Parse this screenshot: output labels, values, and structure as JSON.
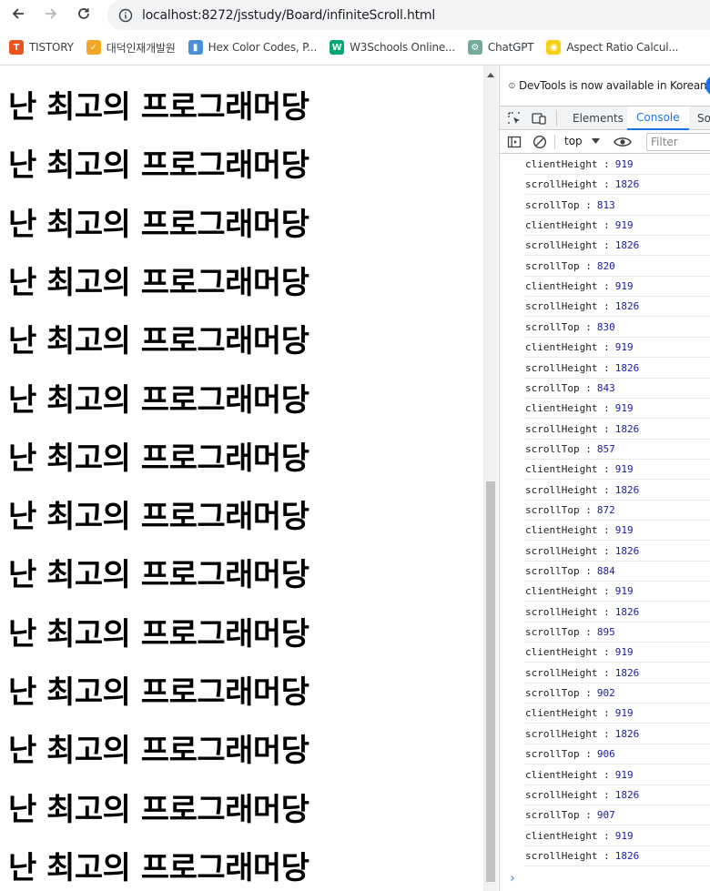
{
  "browser": {
    "url": "localhost:8272/jsstudy/Board/infiniteScroll.html",
    "bookmarks": [
      {
        "label": "TISTORY",
        "icon": "tistory-icon",
        "color": "#eb531f",
        "glyph": "T"
      },
      {
        "label": "대덕인재개발원",
        "icon": "ddit-icon",
        "color": "#f5a623",
        "glyph": "✓"
      },
      {
        "label": "Hex Color Codes, P...",
        "icon": "hexcolor-icon",
        "color": "#4a90d9",
        "glyph": "▮"
      },
      {
        "label": "W3Schools Online...",
        "icon": "w3schools-icon",
        "color": "#04aa6d",
        "glyph": "W"
      },
      {
        "label": "ChatGPT",
        "icon": "chatgpt-icon",
        "color": "#74aa9c",
        "glyph": "⚙"
      },
      {
        "label": "Aspect Ratio Calcul...",
        "icon": "aspect-ratio-icon",
        "color": "#f7d117",
        "glyph": "◉"
      }
    ]
  },
  "page": {
    "line_text": "난 최고의 프로그래머당",
    "line_count": 14
  },
  "devtools": {
    "banner": "DevTools is now available in Korean!",
    "tabs": [
      "Elements",
      "Console",
      "So"
    ],
    "active_tab": "Console",
    "context": "top",
    "filter_placeholder": "Filter",
    "logs": [
      {
        "label": "clientHeight :",
        "value": "919"
      },
      {
        "label": "scrollHeight :",
        "value": "1826"
      },
      {
        "label": "scrollTop :",
        "value": "813"
      },
      {
        "label": "clientHeight :",
        "value": "919"
      },
      {
        "label": "scrollHeight :",
        "value": "1826"
      },
      {
        "label": "scrollTop :",
        "value": "820"
      },
      {
        "label": "clientHeight :",
        "value": "919"
      },
      {
        "label": "scrollHeight :",
        "value": "1826"
      },
      {
        "label": "scrollTop :",
        "value": "830"
      },
      {
        "label": "clientHeight :",
        "value": "919"
      },
      {
        "label": "scrollHeight :",
        "value": "1826"
      },
      {
        "label": "scrollTop :",
        "value": "843"
      },
      {
        "label": "clientHeight :",
        "value": "919"
      },
      {
        "label": "scrollHeight :",
        "value": "1826"
      },
      {
        "label": "scrollTop :",
        "value": "857"
      },
      {
        "label": "clientHeight :",
        "value": "919"
      },
      {
        "label": "scrollHeight :",
        "value": "1826"
      },
      {
        "label": "scrollTop :",
        "value": "872"
      },
      {
        "label": "clientHeight :",
        "value": "919"
      },
      {
        "label": "scrollHeight :",
        "value": "1826"
      },
      {
        "label": "scrollTop :",
        "value": "884"
      },
      {
        "label": "clientHeight :",
        "value": "919"
      },
      {
        "label": "scrollHeight :",
        "value": "1826"
      },
      {
        "label": "scrollTop :",
        "value": "895"
      },
      {
        "label": "clientHeight :",
        "value": "919"
      },
      {
        "label": "scrollHeight :",
        "value": "1826"
      },
      {
        "label": "scrollTop :",
        "value": "902"
      },
      {
        "label": "clientHeight :",
        "value": "919"
      },
      {
        "label": "scrollHeight :",
        "value": "1826"
      },
      {
        "label": "scrollTop :",
        "value": "906"
      },
      {
        "label": "clientHeight :",
        "value": "919"
      },
      {
        "label": "scrollHeight :",
        "value": "1826"
      },
      {
        "label": "scrollTop :",
        "value": "907"
      },
      {
        "label": "clientHeight :",
        "value": "919"
      },
      {
        "label": "scrollHeight :",
        "value": "1826"
      }
    ],
    "prompt": "›"
  }
}
